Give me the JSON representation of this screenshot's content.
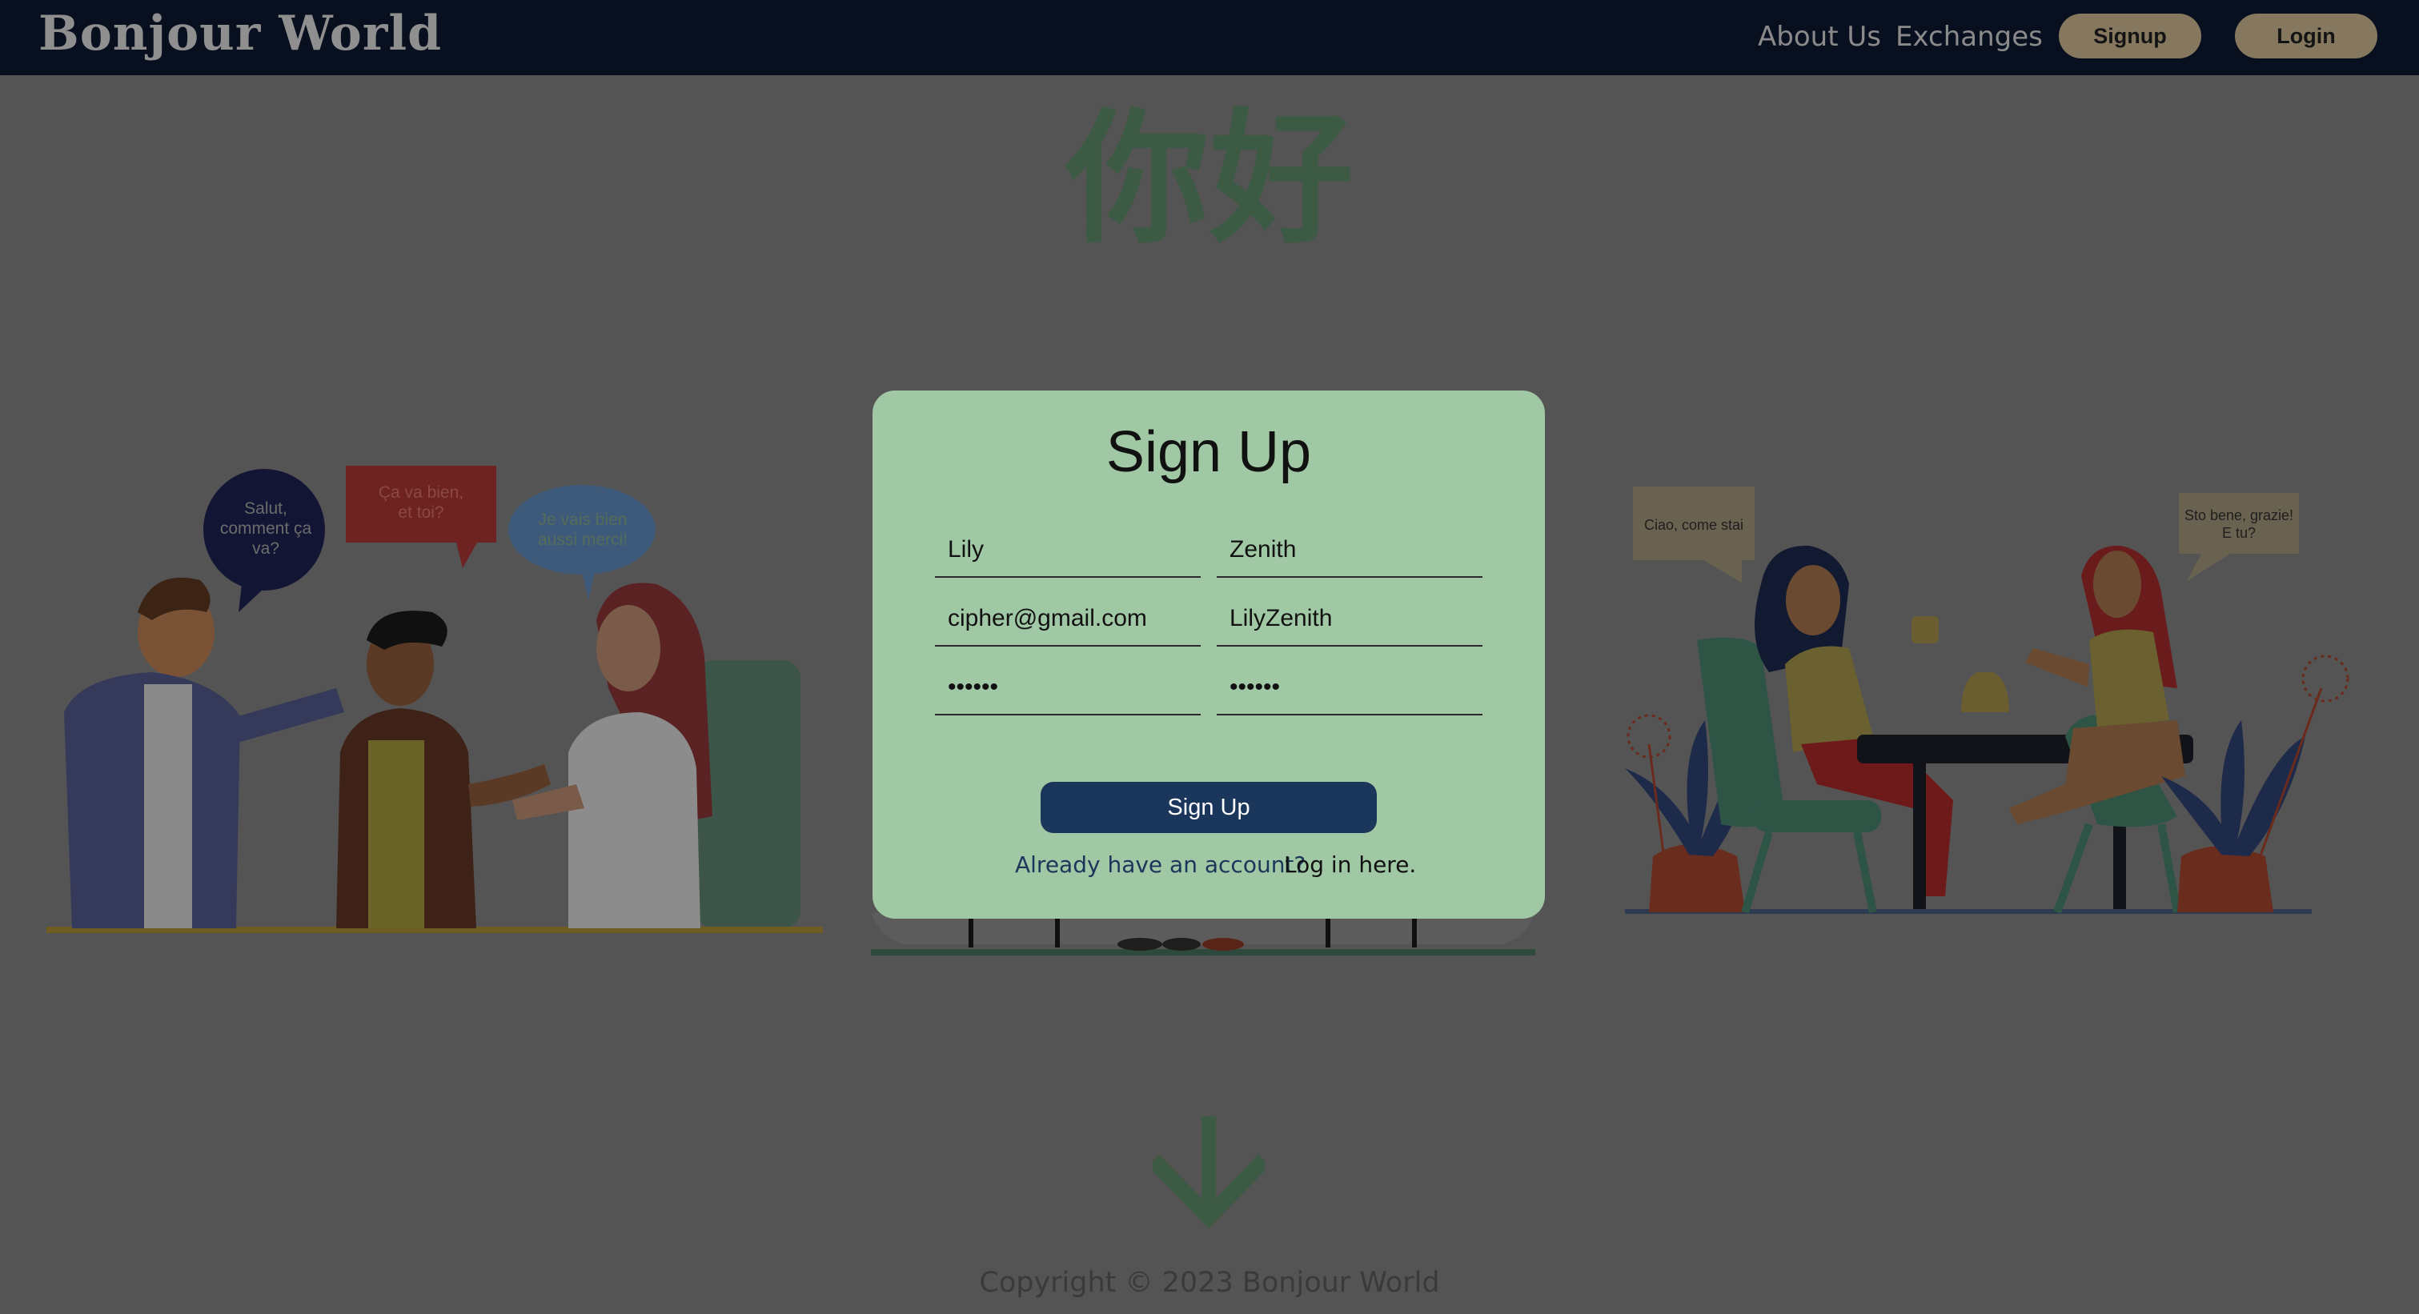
{
  "nav": {
    "brand": "Bonjour World",
    "links": [
      "About Us",
      "Exchanges"
    ],
    "signup_button": "Signup",
    "login_button": "Login"
  },
  "hero": {
    "greeting": "你好"
  },
  "left_scene": {
    "bubbles": [
      "Salut, comment ça va?",
      "Ça va bien, et toi?",
      "Je vais bien aussi merci!"
    ]
  },
  "right_scene": {
    "bubbles": [
      "Ciao, come stai",
      "Sto bene, grazie! E tu?"
    ]
  },
  "modal": {
    "title": "Sign Up",
    "first_name": "Lily",
    "last_name": "Zenith",
    "email": "cipher@gmail.com",
    "username": "LilyZenith",
    "password": "123456",
    "confirm_password": "123456",
    "submit_label": "Sign Up",
    "already_text": "Already have an account?",
    "login_link": "Log in here."
  },
  "footer": {
    "copyright": "Copyright © 2023 Bonjour World"
  },
  "colors": {
    "overlay_background": "#545454",
    "navbar": "#081020",
    "modal_background": "#a0c8a4",
    "primary_button": "#1b365b",
    "nav_button": "#85785e"
  }
}
